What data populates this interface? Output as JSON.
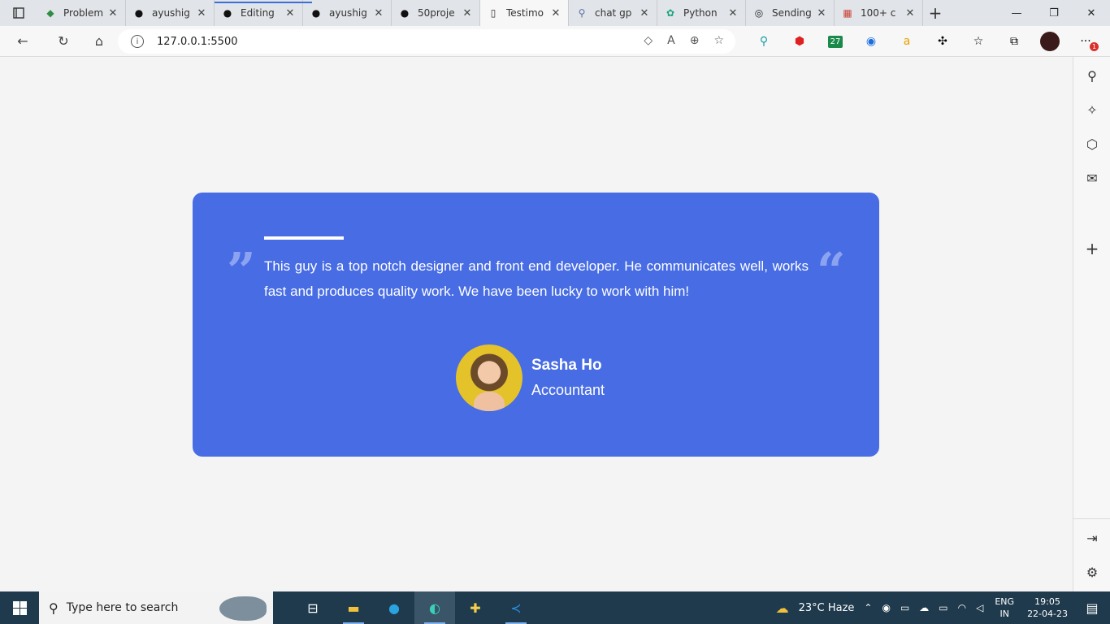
{
  "browser": {
    "tabs": [
      {
        "title": "Problem",
        "icon": "gfg-icon",
        "color": "#2f8d46"
      },
      {
        "title": "ayushig",
        "icon": "github-icon",
        "color": "#111111"
      },
      {
        "title": "Editing",
        "icon": "github-icon",
        "color": "#111111"
      },
      {
        "title": "ayushig",
        "icon": "github-icon",
        "color": "#111111"
      },
      {
        "title": "50proje",
        "icon": "github-icon",
        "color": "#111111"
      },
      {
        "title": "Testimo",
        "icon": "page-icon",
        "color": "#333333"
      },
      {
        "title": "chat gp",
        "icon": "search-icon",
        "color": "#5b6ea8"
      },
      {
        "title": "Python",
        "icon": "openai-icon",
        "color": "#19a37f"
      },
      {
        "title": "Sending",
        "icon": "wordpress-icon",
        "color": "#1d1d1d"
      },
      {
        "title": "100+ c",
        "icon": "pdf-icon",
        "color": "#c9463d"
      }
    ],
    "address": "127.0.0.1:5500"
  },
  "testimonial": {
    "text": "This guy is a top notch designer and front end developer. He communicates well, works fast and produces quality work. We have been lucky to work with him!",
    "name": "Sasha Ho",
    "role": "Accountant",
    "open_quote": "”",
    "close_quote": "“",
    "accent": "#476ce4"
  },
  "taskbar": {
    "search_placeholder": "Type here to search",
    "weather": "23°C  Haze",
    "lang_top": "ENG",
    "lang_bottom": "IN",
    "time": "19:05",
    "date": "22-04-23"
  },
  "extensions": {
    "badge": "27",
    "notification_count": "1"
  }
}
